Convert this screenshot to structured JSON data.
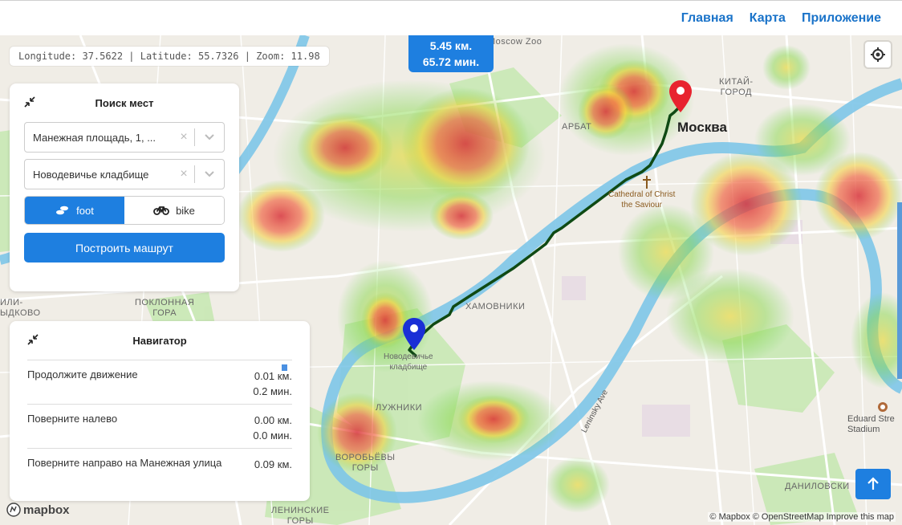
{
  "nav": {
    "home": "Главная",
    "map": "Карта",
    "app": "Приложение"
  },
  "coords": {
    "text": "Longitude: 37.5622 | Latitude: 55.7326 | Zoom: 11.98"
  },
  "route_info": {
    "distance": "5.45 км.",
    "duration": "65.72 мин."
  },
  "search": {
    "title": "Поиск мест",
    "from": "Манежная площадь, 1, ...",
    "to": "Новодевичье кладбище",
    "modes": {
      "foot": "foot",
      "bike": "bike"
    },
    "build": "Построить машрут"
  },
  "navigator": {
    "title": "Навигатор",
    "steps": [
      {
        "text": "Продолжите движение",
        "dist": "0.01 км.",
        "time": "0.2 мин."
      },
      {
        "text": "Поверните налево",
        "dist": "0.00 км.",
        "time": "0.0 мин."
      },
      {
        "text": "Поверните направо на Манежная улица",
        "dist": "0.09 км.",
        "time": ""
      }
    ]
  },
  "map_labels": {
    "moscow": "Москва",
    "moscow_zoo": "Moscow Zoo",
    "arbat": "АРБАТ",
    "kitay_gorod": "КИТАЙ-\nГОРОД",
    "cathedral": "Cathedral of Christ\nthe Saviour",
    "khamovniki": "ХАМОВНИКИ",
    "novodevichye": "Новодевичье\nкладбище",
    "luzhniki": "ЛУЖНИКИ",
    "vorobyovy": "ВОРОБЬЁВЫ\nГОРЫ",
    "poklonnaya": "ПОКЛОННАЯ\nГОРА",
    "fili": "ИЛИ-\nЫДКОВО",
    "leninskie": "ЛЕНИНСКИЕ\nГОРЫ",
    "leninsky_ave": "Leninsky Ave",
    "eduard": "Eduard Stre\nStadium",
    "danilovsky": "ДАНИЛОВСКИ"
  },
  "attribution": "© Mapbox © OpenStreetMap Improve this map",
  "logo": "mapbox",
  "colors": {
    "accent": "#1e7fe0",
    "route": "#0f4a14",
    "start_marker": "#e8232f",
    "end_marker": "#1a2fd6"
  }
}
